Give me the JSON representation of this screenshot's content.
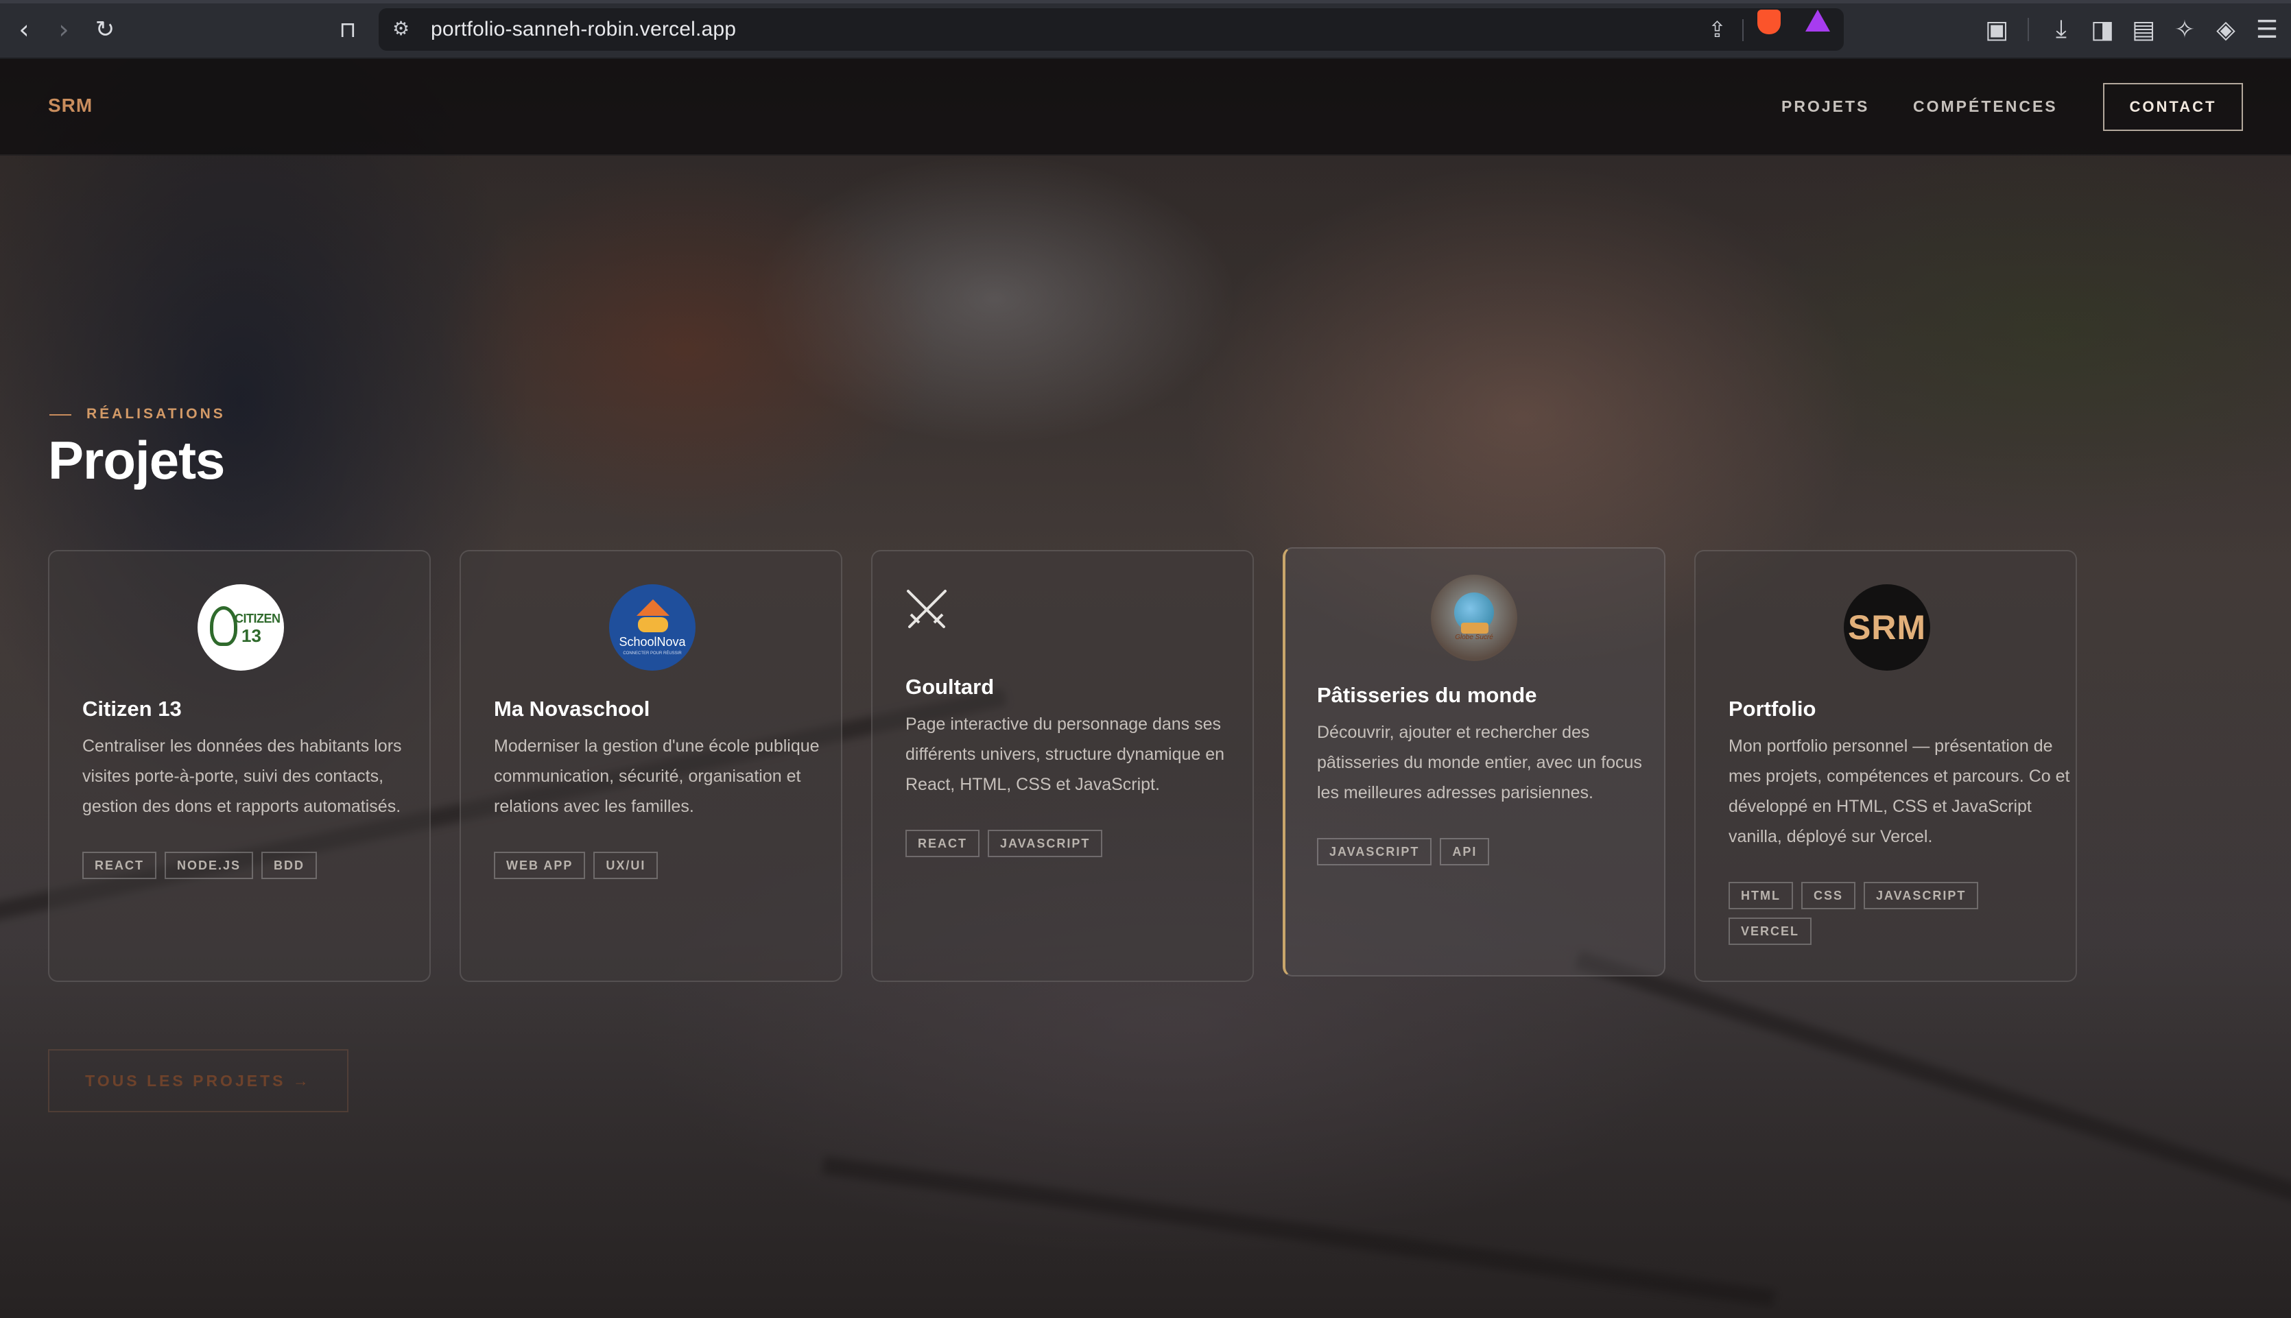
{
  "browser": {
    "url": "portfolio-sanneh-robin.vercel.app",
    "icons": {
      "back": "chevron-left-icon",
      "forward": "chevron-right-icon",
      "reload": "reload-icon",
      "bookmark": "bookmark-icon",
      "site_settings": "tune-icon",
      "share": "share-icon",
      "shields": "brave-shield-icon",
      "rewards": "brave-rewards-icon",
      "reader": "reader-mode-icon",
      "downloads": "download-icon",
      "sidebar": "sidebar-icon",
      "wallet": "wallet-icon",
      "leo": "leo-ai-icon",
      "vpn": "vpn-icon",
      "menu": "menu-icon"
    }
  },
  "header": {
    "logo": "SRM",
    "nav": [
      "PROJETS",
      "COMPÉTENCES"
    ],
    "contact": "CONTACT"
  },
  "section": {
    "eyebrow": "RÉALISATIONS",
    "title": "Projets"
  },
  "projects": [
    {
      "title": "Citizen 13",
      "logo_text": "CITIZEN",
      "logo_num": "13",
      "description": "Centraliser les données des habitants lors visites porte-à-porte, suivi des contacts, gestion des dons et rapports automatisés.",
      "tags": [
        "REACT",
        "NODE.JS",
        "BDD"
      ]
    },
    {
      "title": "Ma Novaschool",
      "logo_text": "SchoolNova",
      "logo_sub": "CONNECTER POUR RÉUSSIR",
      "description": "Moderniser la gestion d'une école publique communication, sécurité, organisation et relations avec les familles.",
      "tags": [
        "WEB APP",
        "UX/UI"
      ]
    },
    {
      "title": "Goultard",
      "description": "Page interactive du personnage dans ses différents univers, structure dynamique en React, HTML, CSS et JavaScript.",
      "tags": [
        "REACT",
        "JAVASCRIPT"
      ]
    },
    {
      "title": "Pâtisseries du monde",
      "logo_text": "Globe Sucré",
      "description": "Découvrir, ajouter et rechercher des pâtisseries du monde entier, avec un focus les meilleures adresses parisiennes.",
      "tags": [
        "JAVASCRIPT",
        "API"
      ]
    },
    {
      "title": "Portfolio",
      "logo_text": "SRM",
      "description": "Mon portfolio personnel — présentation de mes projets, compétences et parcours. Co et développé en HTML, CSS et JavaScript vanilla, déployé sur Vercel.",
      "tags": [
        "HTML",
        "CSS",
        "JAVASCRIPT",
        "VERCEL"
      ]
    }
  ],
  "all_projects_button": "TOUS LES PROJETS →",
  "colors": {
    "accent": "#c98d5d",
    "card_highlight_border": "#c9a66b"
  }
}
